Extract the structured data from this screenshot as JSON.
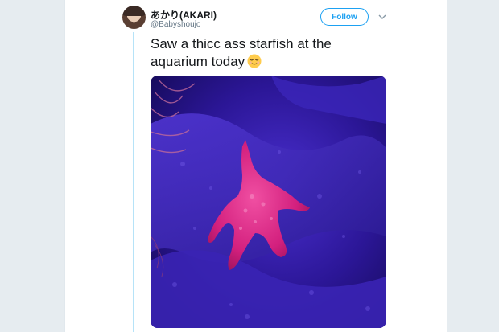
{
  "tweet": {
    "display_name": "あかり(AKARI)",
    "handle": "@Babyshoujo",
    "follow_label": "Follow",
    "text": "Saw a thicc ass starfish at the aquarium today"
  },
  "icons": {
    "avatar": "user-avatar",
    "caret": "chevron-down-icon",
    "emoji": "relieved-face-emoji"
  },
  "colors": {
    "accent": "#1da1f2",
    "thread_line": "#b6e3f8",
    "name": "#14171a",
    "handle": "#657786"
  }
}
